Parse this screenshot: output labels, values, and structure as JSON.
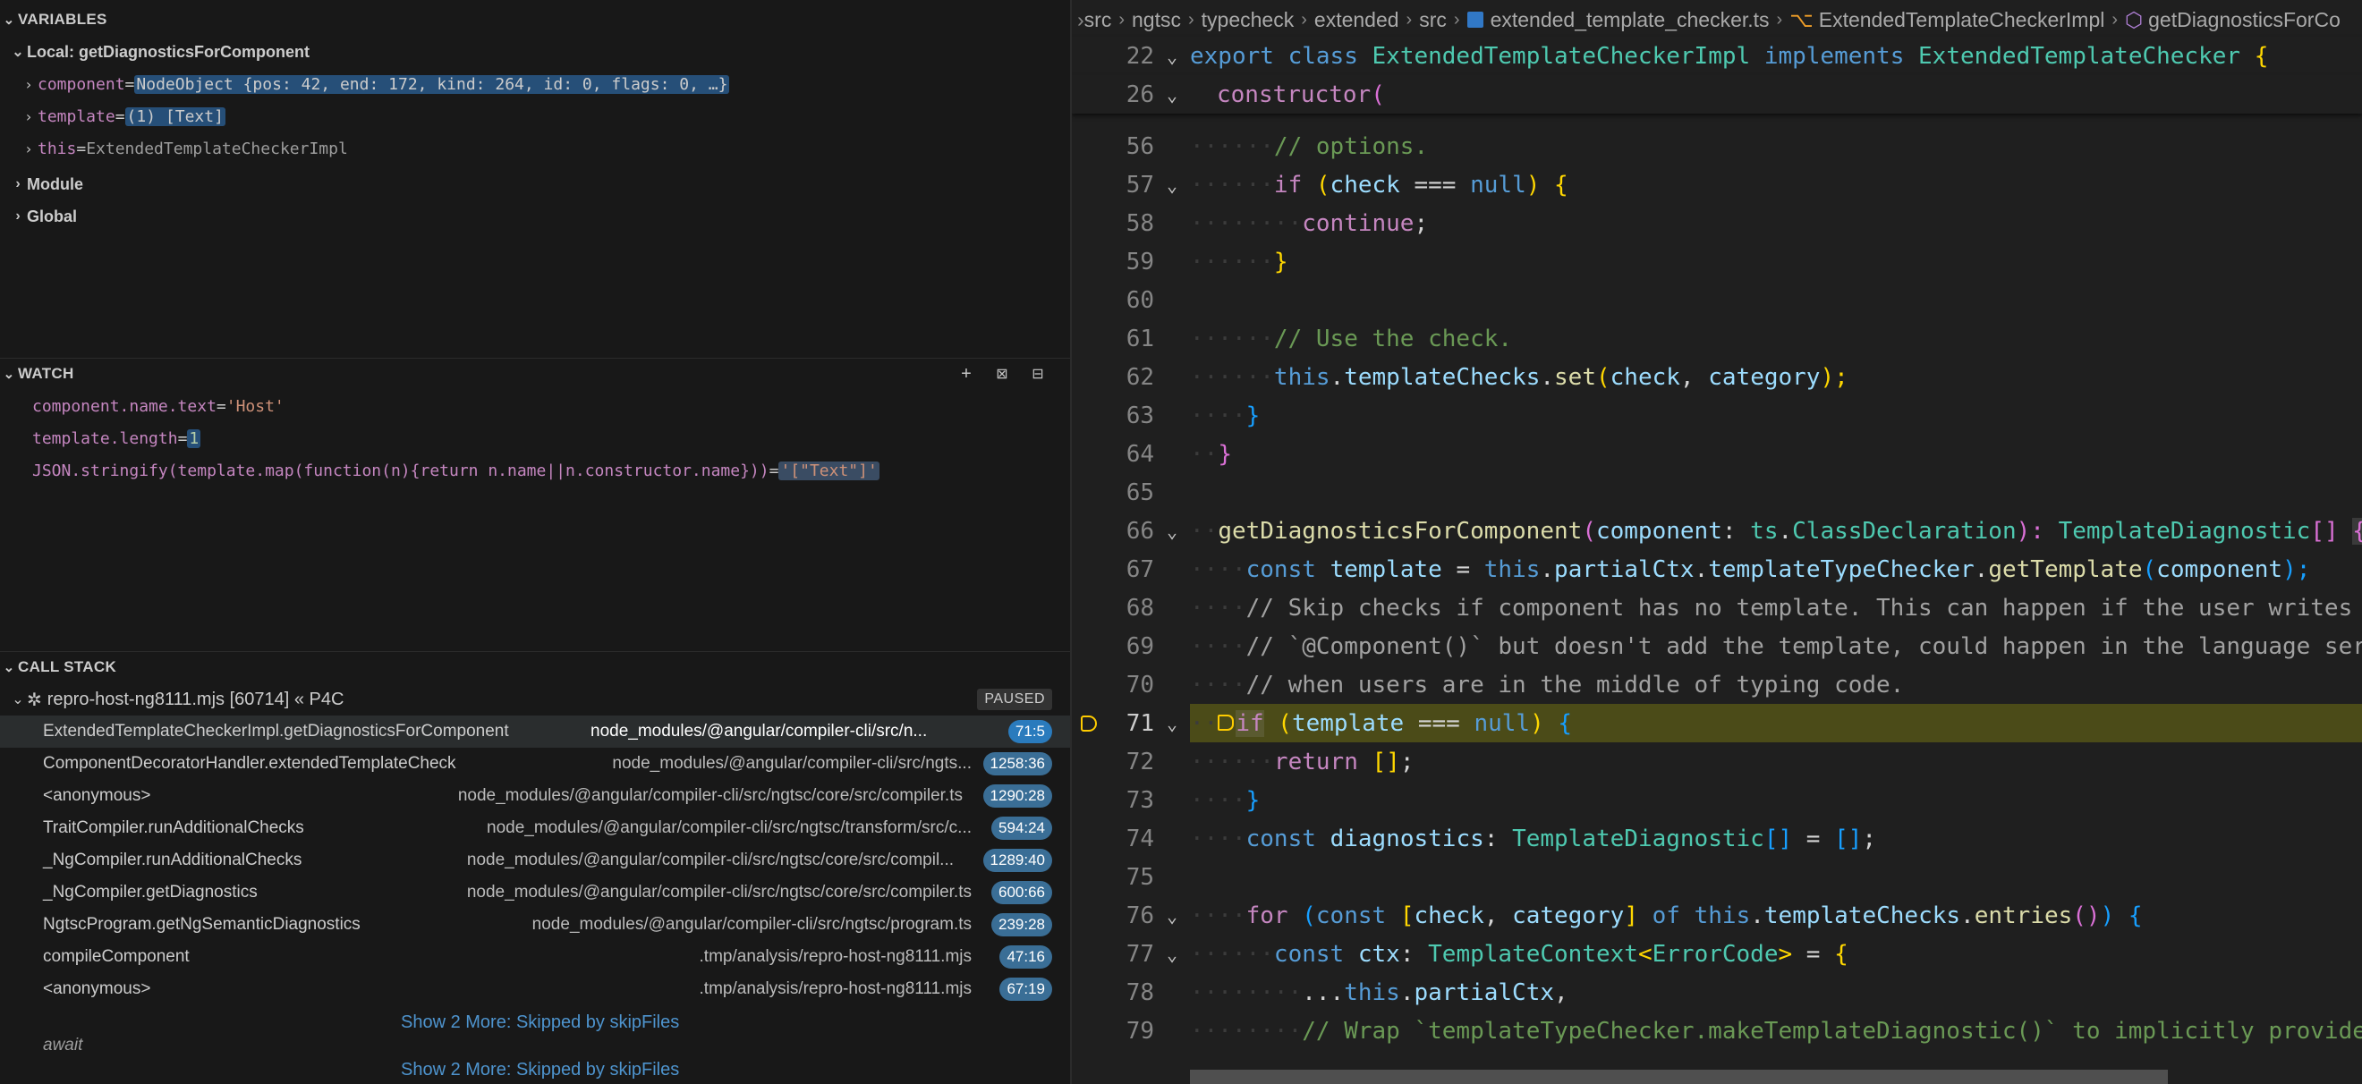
{
  "variables": {
    "title": "VARIABLES",
    "scope_local": "Local: getDiagnosticsForComponent",
    "items": [
      {
        "name": "component",
        "eq": " = ",
        "value": "NodeObject {pos: 42, end: 172, kind: 264, id: 0, flags: 0, …}"
      },
      {
        "name": "template",
        "eq": " = ",
        "value": "(1) [Text]"
      },
      {
        "name": "this",
        "eq": " = ",
        "value": "ExtendedTemplateCheckerImpl"
      }
    ],
    "scope_module": "Module",
    "scope_global": "Global"
  },
  "watch": {
    "title": "WATCH",
    "items": [
      {
        "expr": "component.name.text",
        "eq": " = ",
        "value": "'Host'"
      },
      {
        "expr": "template.length",
        "eq": " = ",
        "value": "1"
      },
      {
        "expr": "JSON.stringify(template.map(function(n){return n.name||n.constructor.name}))",
        "eq": " = ",
        "value": "'[\"Text\"]'"
      }
    ]
  },
  "callstack": {
    "title": "CALL STACK",
    "session": "repro-host-ng8111.mjs [60714] « P4C",
    "status": "PAUSED",
    "frames": [
      {
        "fn": "ExtendedTemplateCheckerImpl.getDiagnosticsForComponent",
        "path": "node_modules/@angular/compiler-cli/src/n...",
        "loc": "71:5"
      },
      {
        "fn": "ComponentDecoratorHandler.extendedTemplateCheck",
        "path": "node_modules/@angular/compiler-cli/src/ngts...",
        "loc": "1258:36"
      },
      {
        "fn": "<anonymous>",
        "path": "node_modules/@angular/compiler-cli/src/ngtsc/core/src/compiler.ts",
        "loc": "1290:28"
      },
      {
        "fn": "TraitCompiler.runAdditionalChecks",
        "path": "node_modules/@angular/compiler-cli/src/ngtsc/transform/src/c...",
        "loc": "594:24"
      },
      {
        "fn": "_NgCompiler.runAdditionalChecks",
        "path": "node_modules/@angular/compiler-cli/src/ngtsc/core/src/compil...",
        "loc": "1289:40"
      },
      {
        "fn": "_NgCompiler.getDiagnostics",
        "path": "node_modules/@angular/compiler-cli/src/ngtsc/core/src/compiler.ts",
        "loc": "600:66"
      },
      {
        "fn": "NgtscProgram.getNgSemanticDiagnostics",
        "path": "node_modules/@angular/compiler-cli/src/ngtsc/program.ts",
        "loc": "239:28"
      },
      {
        "fn": "compileComponent",
        "path": ".tmp/analysis/repro-host-ng8111.mjs",
        "loc": "47:16"
      },
      {
        "fn": "<anonymous>",
        "path": ".tmp/analysis/repro-host-ng8111.mjs",
        "loc": "67:19"
      }
    ],
    "show_more_1": "Show 2 More: Skipped by skipFiles",
    "await_label": "await",
    "show_more_2": "Show 2 More: Skipped by skipFiles"
  },
  "breadcrumbs": [
    "src",
    "ngtsc",
    "typecheck",
    "extended",
    "src",
    "extended_template_checker.ts",
    "ExtendedTemplateCheckerImpl",
    "getDiagnosticsForCo"
  ],
  "editor": {
    "current_line": "71",
    "lines": [
      {
        "n": "22",
        "fold": "⌄"
      },
      {
        "n": "26",
        "fold": "⌄"
      },
      {
        "n": "56",
        "fold": ""
      },
      {
        "n": "57",
        "fold": "⌄"
      },
      {
        "n": "58",
        "fold": ""
      },
      {
        "n": "59",
        "fold": ""
      },
      {
        "n": "60",
        "fold": ""
      },
      {
        "n": "61",
        "fold": ""
      },
      {
        "n": "62",
        "fold": ""
      },
      {
        "n": "63",
        "fold": ""
      },
      {
        "n": "64",
        "fold": ""
      },
      {
        "n": "65",
        "fold": ""
      },
      {
        "n": "66",
        "fold": "⌄"
      },
      {
        "n": "67",
        "fold": ""
      },
      {
        "n": "68",
        "fold": ""
      },
      {
        "n": "69",
        "fold": ""
      },
      {
        "n": "70",
        "fold": ""
      },
      {
        "n": "71",
        "fold": "⌄"
      },
      {
        "n": "72",
        "fold": ""
      },
      {
        "n": "73",
        "fold": ""
      },
      {
        "n": "74",
        "fold": ""
      },
      {
        "n": "75",
        "fold": ""
      },
      {
        "n": "76",
        "fold": "⌄"
      },
      {
        "n": "77",
        "fold": "⌄"
      },
      {
        "n": "78",
        "fold": ""
      },
      {
        "n": "79",
        "fold": ""
      }
    ],
    "tokens": {
      "l22": [
        "export",
        " ",
        "class",
        " ",
        "ExtendedTemplateCheckerImpl",
        " ",
        "implements",
        " ",
        "ExtendedTemplateChecker",
        " ",
        "{"
      ],
      "l26": [
        "constructor",
        "("
      ],
      "l56": [
        "// options."
      ],
      "l57": [
        "if",
        " (",
        "check",
        " === ",
        "null",
        ") ",
        "{"
      ],
      "l58": [
        "continue",
        ";"
      ],
      "l59": [
        "}"
      ],
      "l61": [
        "// Use the check."
      ],
      "l62": [
        "this",
        ".",
        "templateChecks",
        ".",
        "set",
        "(",
        "check",
        ", ",
        "category",
        ");"
      ],
      "l63": [
        "}"
      ],
      "l64": [
        "}"
      ],
      "l66": [
        "getDiagnosticsForComponent",
        "(",
        "component",
        ": ",
        "ts",
        ".",
        "ClassDeclaration",
        "): ",
        "TemplateDiagnostic",
        "[]",
        " ",
        "{"
      ],
      "l67": [
        "const",
        " ",
        "template",
        " = ",
        "this",
        ".",
        "partialCtx",
        ".",
        "templateTypeChecker",
        ".",
        "getTemplate",
        "(",
        "component",
        ");"
      ],
      "l68": [
        "// Skip checks if component has no template. This can happen if the user writes a"
      ],
      "l69": [
        "// `@Component()` but doesn't add the template, could happen in the language servic"
      ],
      "l70": [
        "// when users are in the middle of typing code."
      ],
      "l71": [
        "if",
        " (",
        "template",
        " === ",
        "null",
        ") ",
        "{"
      ],
      "l72": [
        "return",
        " ",
        "[]",
        ";"
      ],
      "l73": [
        "}"
      ],
      "l74": [
        "const",
        " ",
        "diagnostics",
        ": ",
        "TemplateDiagnostic",
        "[]",
        " = ",
        "[]",
        ";"
      ],
      "l76": [
        "for",
        " (",
        "const",
        " ",
        "[",
        "check",
        ", ",
        "category",
        "]",
        " of ",
        "this",
        ".",
        "templateChecks",
        ".",
        "entries",
        "()",
        ") ",
        "{"
      ],
      "l77": [
        "const",
        " ",
        "ctx",
        ": ",
        "TemplateContext",
        "<",
        "ErrorCode",
        ">",
        " = ",
        "{"
      ],
      "l78": [
        "...",
        "this",
        ".",
        "partialCtx",
        ","
      ],
      "l79": [
        "// Wrap `templateTypeChecker.makeTemplateDiagnostic()` to implicitly provide al"
      ]
    }
  },
  "colors": {
    "keyword": "#569cd6",
    "control": "#c586c0",
    "type": "#4ec9b0",
    "function": "#dcdcaa",
    "variable": "#9cdcfe",
    "comment": "#6a9955",
    "current_line": "#4b4b18",
    "breakpoint": "#ffcc00"
  },
  "icons": [
    "add-expression-icon",
    "collapse-all-icon",
    "remove-all-icon",
    "bug-icon",
    "ts-file-icon",
    "class-symbol-icon",
    "method-symbol-icon"
  ]
}
